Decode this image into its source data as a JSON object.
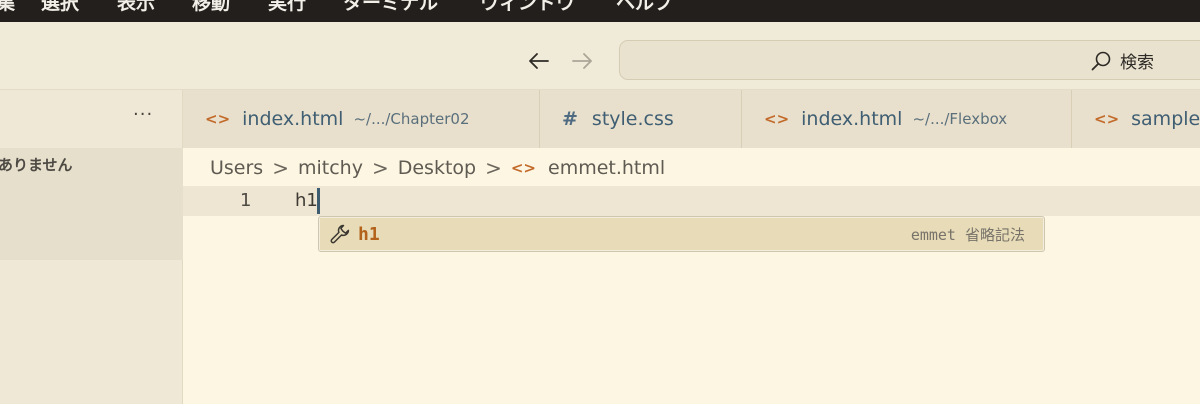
{
  "menubar": {
    "items": [
      "集",
      "選択",
      "表示",
      "移動",
      "実行",
      "ターミナル",
      "ウィンドウ",
      "ヘルプ"
    ]
  },
  "titlebar": {
    "back_icon": "arrow-left-icon",
    "forward_icon": "arrow-right-icon",
    "search": {
      "label": "検索",
      "icon": "search-icon"
    }
  },
  "sidebar": {
    "more": "···",
    "empty_message": "ありません"
  },
  "tabs": [
    {
      "icon": "<>",
      "label": "index.html",
      "description": "~/.../Chapter02"
    },
    {
      "icon": "#",
      "label": "style.css",
      "description": ""
    },
    {
      "icon": "<>",
      "label": "index.html",
      "description": "~/.../Flexbox"
    },
    {
      "icon": "<>",
      "label": "sample",
      "description": ""
    }
  ],
  "breadcrumb": {
    "parts": [
      "Users",
      "mitchy",
      "Desktop"
    ],
    "separator": ">",
    "file_icon": "<>",
    "file": "emmet.html"
  },
  "editor": {
    "line_number": "1",
    "code": "h1"
  },
  "suggest": {
    "icon": "wrench-icon",
    "label": "h1",
    "detail": "emmet 省略記法"
  },
  "colors": {
    "menubar_bg": "#231f1c",
    "editor_bg": "#fdf6e3",
    "accent_orange": "#c26a2a",
    "tab_text": "#3f5e73",
    "suggest_highlight": "#e8dbb7"
  }
}
